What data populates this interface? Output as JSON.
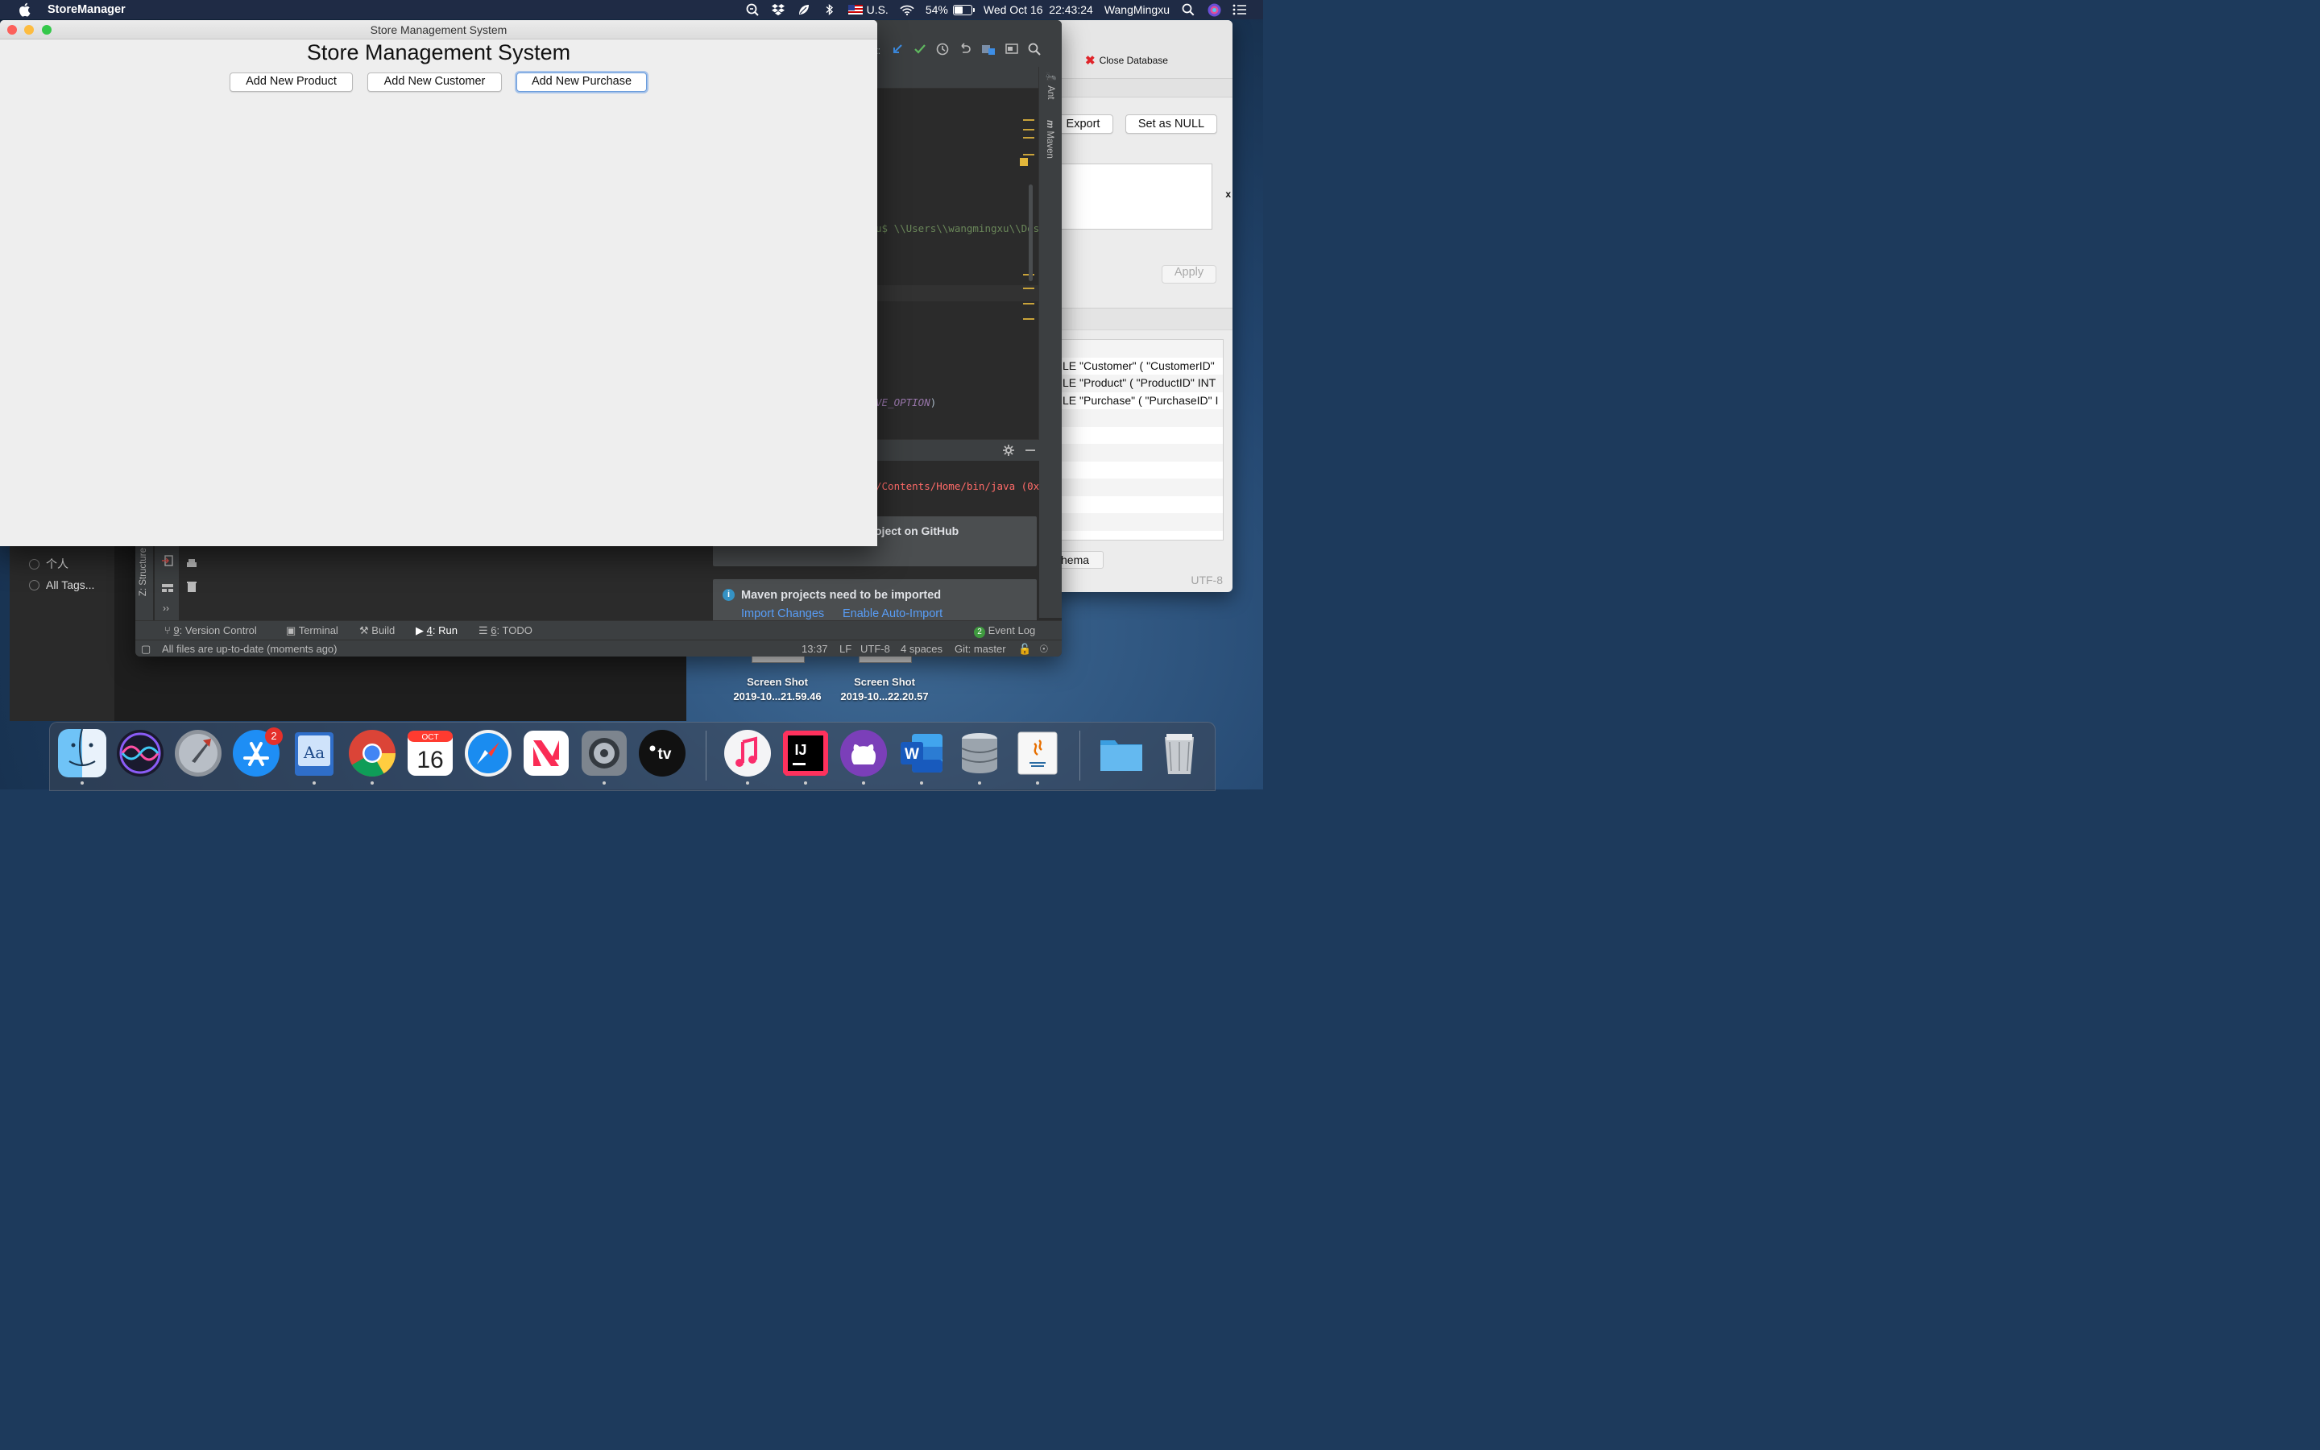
{
  "menubar": {
    "app_name": "StoreManager",
    "input_source": "U.S.",
    "battery_percent": "54%",
    "battery_level": 0.54,
    "datetime": "Wed Oct 16  22:43:24",
    "user": "WangMingxu"
  },
  "store_window": {
    "title": "Store Management System",
    "heading": "Store Management System",
    "buttons": [
      "Add New Product",
      "Add New Customer",
      "Add New Purchase"
    ],
    "focused_button": "Add New Purchase"
  },
  "ide": {
    "toolbar_partial_label": "t:",
    "code_path": "u$ \\\\Users\\\\wangmingxu\\\\Des",
    "code_option": "VE_OPTION",
    "code_option_tail": ")",
    "run_path": "/Contents/Home/bin/java (0x",
    "sidebar_tools": [
      "Ant",
      "Maven"
    ],
    "github_notice_partial": "oject on GitHub",
    "maven_notice": {
      "title": "Maven projects need to be imported",
      "link_import": "Import Changes",
      "link_auto": "Enable Auto-Import"
    },
    "structure_tab": "Z: Structure",
    "bottom_tabs": [
      {
        "num": "9",
        "label": ": Version Control"
      },
      {
        "num": "",
        "label": "Terminal"
      },
      {
        "num": "",
        "label": "Build"
      },
      {
        "num": "4",
        "label": ": Run"
      },
      {
        "num": "6",
        "label": ": TODO"
      }
    ],
    "event_log_count": "2",
    "event_log_label": "Event Log",
    "status_message": "All files are up-to-date (moments ago)",
    "caret_position": "13:37",
    "line_separator": "LF",
    "encoding": "UTF-8",
    "indent": "4 spaces",
    "git_branch": "Git: master"
  },
  "db_window": {
    "close_database_label": "Close Database",
    "export_label": "Export",
    "set_null_label": "Set as NULL",
    "apply_label": "Apply",
    "partial_side_label": "x",
    "schema_rows": [
      "",
      "LE \"Customer\" ( \"CustomerID\"",
      "LE \"Product\" ( \"ProductID\" INT",
      "LE \"Purchase\" ( \"PurchaseID\" I",
      "",
      "",
      "",
      "",
      "",
      "",
      ""
    ],
    "schema_tab_partial": "hema",
    "encoding": "UTF-8"
  },
  "finder": {
    "tags": [
      "个人",
      "All Tags..."
    ]
  },
  "desktop_files": [
    {
      "line1": "Screen Shot",
      "line2": "2019-10...21.59.46"
    },
    {
      "line1": "Screen Shot",
      "line2": "2019-10...22.20.57"
    }
  ],
  "dock": {
    "apps": [
      "Finder",
      "Siri",
      "Launchpad",
      "App Store",
      "Dictionary",
      "Google Chrome",
      "Calendar",
      "Safari",
      "News",
      "System Preferences",
      "Apple TV",
      "Music",
      "IntelliJ IDEA",
      "GitHub Desktop",
      "Microsoft Word",
      "DB Browser for SQLite",
      "Java"
    ],
    "app_store_badge": "2",
    "calendar_month": "OCT",
    "calendar_day": "16",
    "tv_label": "tv",
    "ij_label": "IJ",
    "word_label": "W"
  },
  "colors": {
    "menubar_bg": "#1f2b45",
    "ide_bg": "#2b2b2b",
    "ide_panel": "#3c3f41",
    "link_blue": "#589df6",
    "focus_ring": "#6b9ddc",
    "close_red": "#fc605b",
    "minimize_yellow": "#fdbc40",
    "zoom_green": "#34c84a"
  }
}
